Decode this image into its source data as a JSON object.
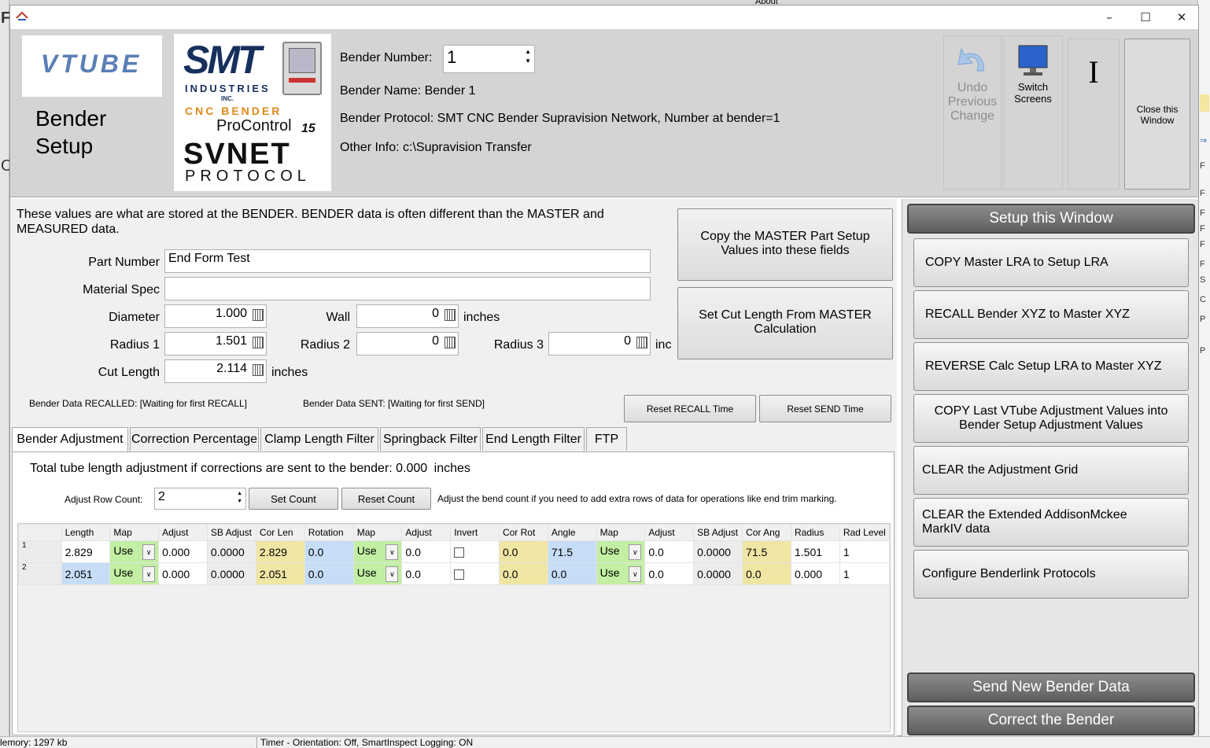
{
  "header": {
    "logo_vtube": "VTUBE",
    "title_line1": "Bender",
    "title_line2": "Setup",
    "smt_logo": "SMT",
    "smt_industries": "INDUSTRIES",
    "smt_inc": "INC.",
    "cnc_bender": "CNC BENDER",
    "procontrol": "ProControl",
    "procontrol_ver": "15",
    "svnet": "SVNET",
    "protocol": "PROTOCOL",
    "bender_number_label": "Bender Number:",
    "bender_number_value": "1",
    "bender_name": "Bender Name: Bender 1",
    "bender_protocol": "Bender Protocol: SMT CNC Bender Supravision Network, Number at bender=1",
    "other_info": "Other Info: c:\\Supravision Transfer",
    "undo_label_1": "Undo",
    "undo_label_2": "Previous",
    "undo_label_3": "Change",
    "switch_label_1": "Switch",
    "switch_label_2": "Screens",
    "cursor_glyph": "I",
    "close_label_1": "Close this",
    "close_label_2": "Window"
  },
  "form": {
    "info_text": "These values are what are stored at the BENDER.  BENDER data is often different than the MASTER and MEASURED data.",
    "part_number_label": "Part Number",
    "part_number_value": "End Form Test",
    "material_spec_label": "Material Spec",
    "material_spec_value": "",
    "diameter_label": "Diameter",
    "diameter_value": "1.000",
    "wall_label": "Wall",
    "wall_value": "0",
    "wall_units": "inches",
    "radius1_label": "Radius 1",
    "radius1_value": "1.501",
    "radius2_label": "Radius 2",
    "radius2_value": "0",
    "radius3_label": "Radius 3",
    "radius3_value": "0",
    "radius3_units": "inc",
    "cut_length_label": "Cut Length",
    "cut_length_value": "2.114",
    "cut_length_units": "inches",
    "copy_master_btn": "Copy the MASTER Part Setup Values into these fields",
    "set_cut_btn": "Set Cut Length From MASTER Calculation",
    "recalled_text": "Bender Data RECALLED: [Waiting for first RECALL]",
    "sent_text": "Bender Data SENT: [Waiting for first SEND]",
    "reset_recall_btn": "Reset RECALL Time",
    "reset_send_btn": "Reset SEND Time"
  },
  "tabs": [
    "Bender Adjustment",
    "Correction Percentage",
    "Clamp Length Filter",
    "Springback Filter",
    "End Length Filter",
    "FTP"
  ],
  "adjust": {
    "total_text": "Total tube length adjustment if corrections are sent to the bender: 0.000",
    "total_units": "inches",
    "row_count_label": "Adjust Row Count:",
    "row_count_value": "2",
    "set_count_btn": "Set Count",
    "reset_count_btn": "Reset Count",
    "help_text": "Adjust the bend count if you need to add extra rows of data for operations like end trim marking."
  },
  "grid": {
    "headers": [
      "",
      "Length",
      "Map",
      "Adjust",
      "SB Adjust",
      "Cor Len",
      "Rotation",
      "Map",
      "Adjust",
      "Invert",
      "Cor Rot",
      "Angle",
      "Map",
      "Adjust",
      "SB Adjust",
      "Cor Ang",
      "Radius",
      "Rad Level"
    ],
    "rows": [
      {
        "idx": "1",
        "length": "2.829",
        "map1": "Use",
        "adjust1": "0.000",
        "sb1": "0.0000",
        "corlen": "2.829",
        "rotation": "0.0",
        "map2": "Use",
        "adjust2": "0.0",
        "invert": false,
        "corrot": "0.0",
        "angle": "71.5",
        "map3": "Use",
        "adjust3": "0.0",
        "sb3": "0.0000",
        "corang": "71.5",
        "radius": "1.501",
        "radlevel": "1"
      },
      {
        "idx": "2",
        "length": "2.051",
        "map1": "Use",
        "adjust1": "0.000",
        "sb1": "0.0000",
        "corlen": "2.051",
        "rotation": "0.0",
        "map2": "Use",
        "adjust2": "0.0",
        "invert": false,
        "corrot": "0.0",
        "angle": "0.0",
        "map3": "Use",
        "adjust3": "0.0",
        "sb3": "0.0000",
        "corang": "0.0",
        "radius": "0.000",
        "radlevel": "1"
      }
    ]
  },
  "sidebar": {
    "setup_title": "Setup this Window",
    "items": [
      "COPY Master LRA to Setup LRA",
      "RECALL Bender XYZ to Master XYZ",
      "REVERSE Calc Setup LRA to Master XYZ",
      "COPY Last VTube Adjustment Values into Bender Setup Adjustment Values",
      "CLEAR the Adjustment Grid",
      "CLEAR the Extended AddisonMckee MarkIV data",
      "Configure Benderlink Protocols"
    ],
    "send_btn": "Send New Bender Data",
    "correct_btn": "Correct the Bender"
  },
  "statusbar": {
    "memory": "lemory: 1297 kb",
    "timer": "Timer - Orientation: Off, SmartInspect Logging: ON"
  },
  "background": {
    "about": "About"
  }
}
